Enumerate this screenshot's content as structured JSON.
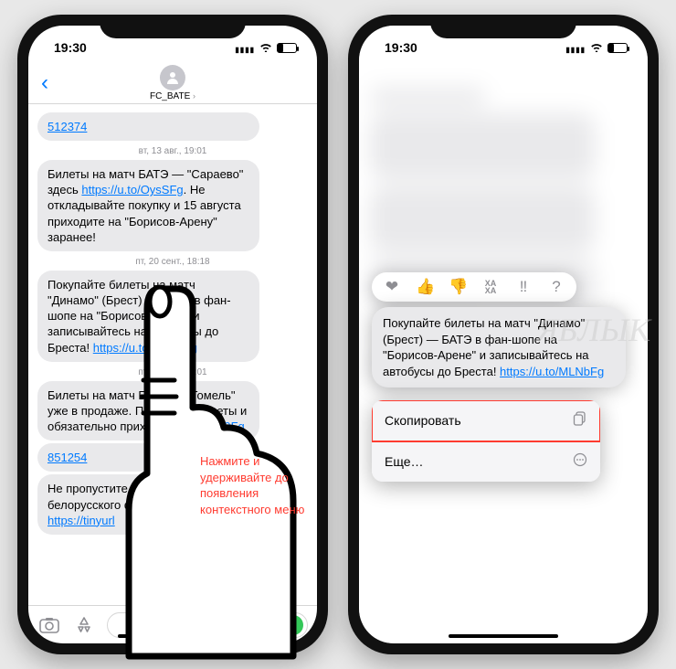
{
  "status": {
    "time": "19:30"
  },
  "left": {
    "contact": "FC_BATE",
    "messages": [
      {
        "type": "bubble",
        "link": "512374"
      },
      {
        "type": "ts",
        "text": "вт, 13 авг., 19:01"
      },
      {
        "type": "bubble",
        "pre": "Билеты на матч БАТЭ — \"Сараево\" здесь ",
        "link": "https://u.to/OysSFg",
        "post": ". Не откладывайте покупку и 15 августа приходите на \"Борисов-Арену\" заранее!"
      },
      {
        "type": "ts",
        "text": "пт, 20 сент., 18:18"
      },
      {
        "type": "bubble",
        "pre": "Покупайте билеты на матч \"Динамо\" (Брест) — БАТЭ в фан-шопе на \"Борисов-Арене\" и записывайтесь на автобусы до Бреста! ",
        "link": "https://u.to/MLNbFg",
        "post": ""
      },
      {
        "type": "ts",
        "text": "пт, 18 окт., 18:01"
      },
      {
        "type": "bubble",
        "pre": "Билеты на матч БАТЭ — \"Гомель\" уже в продаже. Покупайте билеты и обязательно приходите! ",
        "link": "u.to/r6d9Fg",
        "post": ""
      },
      {
        "type": "bubble",
        "link": "851254"
      },
      {
        "type": "bubble",
        "pre": "Не пропустите матч лидеров белорусского футбола!",
        "link": "https://tinyurl"
      }
    ],
    "instruction": "Нажмите и удерживайте до появления контекстного меню"
  },
  "right": {
    "tapbacks": [
      "❤",
      "👍",
      "👎",
      "ХА ХА",
      "‼",
      "?"
    ],
    "focusMessage": {
      "pre": "Покупайте билеты на матч \"Динамо\" (Брест) — БАТЭ в фан-шопе на \"Борисов-Арене\" и записывайтесь на автобусы до Бреста! ",
      "link": "https://u.to/MLNbFg"
    },
    "menu": {
      "copy": "Скопировать",
      "more": "Еще…"
    }
  },
  "watermark": "ЯБЛЫК"
}
